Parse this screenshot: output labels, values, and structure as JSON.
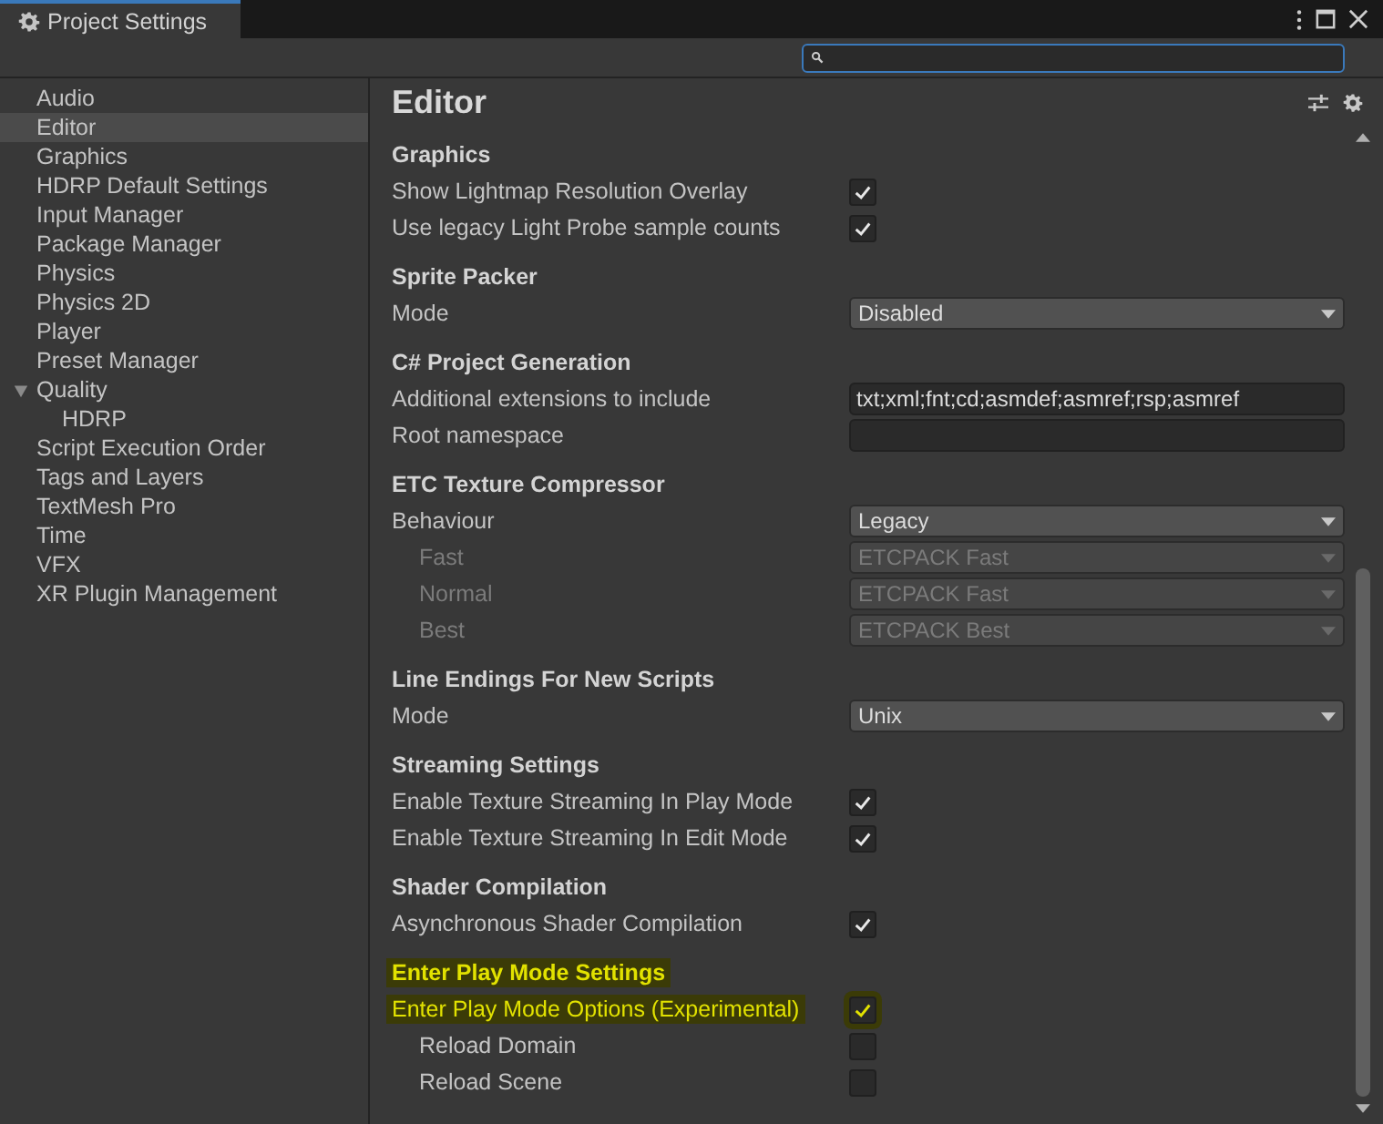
{
  "window": {
    "title": "Project Settings"
  },
  "sidebar": {
    "items": [
      {
        "label": "Audio",
        "selected": false
      },
      {
        "label": "Editor",
        "selected": true
      },
      {
        "label": "Graphics",
        "selected": false
      },
      {
        "label": "HDRP Default Settings",
        "selected": false
      },
      {
        "label": "Input Manager",
        "selected": false
      },
      {
        "label": "Package Manager",
        "selected": false
      },
      {
        "label": "Physics",
        "selected": false
      },
      {
        "label": "Physics 2D",
        "selected": false
      },
      {
        "label": "Player",
        "selected": false
      },
      {
        "label": "Preset Manager",
        "selected": false
      },
      {
        "label": "Quality",
        "selected": false,
        "expanded": true,
        "children": [
          {
            "label": "HDRP",
            "selected": false
          }
        ]
      },
      {
        "label": "Script Execution Order",
        "selected": false
      },
      {
        "label": "Tags and Layers",
        "selected": false
      },
      {
        "label": "TextMesh Pro",
        "selected": false
      },
      {
        "label": "Time",
        "selected": false
      },
      {
        "label": "VFX",
        "selected": false
      },
      {
        "label": "XR Plugin Management",
        "selected": false
      }
    ]
  },
  "panel": {
    "title": "Editor",
    "sections": [
      {
        "title": "Graphics",
        "highlighted": false,
        "rows": [
          {
            "kind": "checkbox",
            "label": "Show Lightmap Resolution Overlay",
            "checked": true,
            "disabled": false,
            "highlighted": false
          },
          {
            "kind": "checkbox",
            "label": "Use legacy Light Probe sample counts",
            "checked": true,
            "disabled": false,
            "highlighted": false
          }
        ]
      },
      {
        "title": "Sprite Packer",
        "highlighted": false,
        "rows": [
          {
            "kind": "dropdown",
            "label": "Mode",
            "value": "Disabled",
            "disabled": false,
            "highlighted": false
          }
        ]
      },
      {
        "title": "C# Project Generation",
        "highlighted": false,
        "rows": [
          {
            "kind": "text",
            "label": "Additional extensions to include",
            "value": "txt;xml;fnt;cd;asmdef;asmref;rsp;asmref",
            "disabled": false,
            "highlighted": false
          },
          {
            "kind": "text",
            "label": "Root namespace",
            "disabled": false,
            "highlighted": false
          }
        ]
      },
      {
        "title": "ETC Texture Compressor",
        "highlighted": false,
        "rows": [
          {
            "kind": "dropdown",
            "label": "Behaviour",
            "value": "Legacy",
            "disabled": false,
            "highlighted": false,
            "children": [
              {
                "kind": "dropdown",
                "label": "Fast",
                "value": "ETCPACK Fast",
                "disabled": true,
                "highlighted": false
              },
              {
                "kind": "dropdown",
                "label": "Normal",
                "value": "ETCPACK Fast",
                "disabled": true,
                "highlighted": false
              },
              {
                "kind": "dropdown",
                "label": "Best",
                "value": "ETCPACK Best",
                "disabled": true,
                "highlighted": false
              }
            ]
          }
        ]
      },
      {
        "title": "Line Endings For New Scripts",
        "highlighted": false,
        "rows": [
          {
            "kind": "dropdown",
            "label": "Mode",
            "value": "Unix",
            "disabled": false,
            "highlighted": false
          }
        ]
      },
      {
        "title": "Streaming Settings",
        "highlighted": false,
        "rows": [
          {
            "kind": "checkbox",
            "label": "Enable Texture Streaming In Play Mode",
            "checked": true,
            "disabled": false,
            "highlighted": false
          },
          {
            "kind": "checkbox",
            "label": "Enable Texture Streaming In Edit Mode",
            "checked": true,
            "disabled": false,
            "highlighted": false
          }
        ]
      },
      {
        "title": "Shader Compilation",
        "highlighted": false,
        "rows": [
          {
            "kind": "checkbox",
            "label": "Asynchronous Shader Compilation",
            "checked": true,
            "disabled": false,
            "highlighted": false
          }
        ]
      },
      {
        "title": "Enter Play Mode Settings",
        "highlighted": true,
        "rows": [
          {
            "kind": "checkbox",
            "label": "Enter Play Mode Options (Experimental)",
            "checked": true,
            "disabled": false,
            "highlighted": true,
            "children": [
              {
                "kind": "checkbox",
                "label": "Reload Domain",
                "checked": false,
                "disabled": false,
                "highlighted": false
              },
              {
                "kind": "checkbox",
                "label": "Reload Scene",
                "checked": false,
                "disabled": false,
                "highlighted": false
              }
            ]
          }
        ]
      }
    ]
  }
}
